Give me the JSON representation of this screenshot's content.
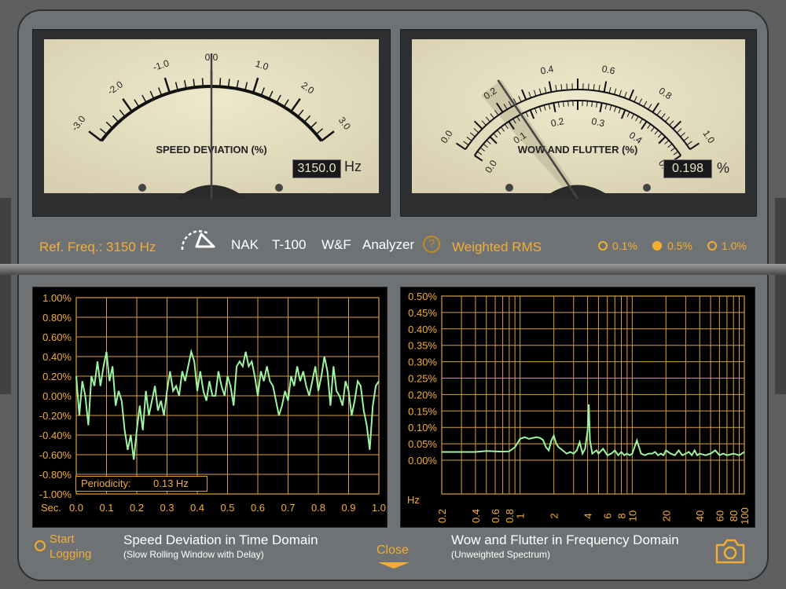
{
  "left_meter": {
    "title": "SPEED DEVIATION (%)",
    "scale_labels": [
      "-3.0",
      "-2.0",
      "-1.0",
      "0.0",
      "1.0",
      "2.0",
      "3.0"
    ],
    "readout": "3150.0",
    "unit": "Hz",
    "needle_value": 0.0
  },
  "right_meter": {
    "title": "WOW AND FLUTTER (%)",
    "outer_labels": [
      "0.0",
      "0.2",
      "0.4",
      "0.6",
      "0.8",
      "1.0"
    ],
    "inner_labels": [
      "0.0",
      "0.1",
      "0.2",
      "0.3",
      "0.4",
      "0.5"
    ],
    "readout": "0.198",
    "unit": "%",
    "needle_value": 0.198
  },
  "controls": {
    "ref_freq": "Ref. Freq.: 3150 Hz",
    "brand": "NAK",
    "model": "T-100",
    "wf": "W&F",
    "analyzer": "Analyzer",
    "help": "?",
    "weighting": "Weighted RMS",
    "options": [
      {
        "label": "0.1%",
        "selected": false
      },
      {
        "label": "0.5%",
        "selected": true
      },
      {
        "label": "1.0%",
        "selected": false
      }
    ]
  },
  "chart_data": [
    {
      "type": "line",
      "title": "Speed Deviation in Time Domain",
      "subtitle": "(Slow Rolling Window with Delay)",
      "y_ticks": [
        "1.00%",
        "0.80%",
        "0.60%",
        "0.40%",
        "0.20%",
        "0.00%",
        "-0.20%",
        "-0.40%",
        "-0.60%",
        "-0.80%",
        "-1.00%"
      ],
      "x_label": "Sec.",
      "x_ticks": [
        "0.0",
        "0.1",
        "0.2",
        "0.3",
        "0.4",
        "0.5",
        "0.6",
        "0.7",
        "0.8",
        "0.9",
        "1.0"
      ],
      "xlim": [
        0,
        1
      ],
      "ylim": [
        -1,
        1
      ],
      "annotation_label": "Periodicity:",
      "annotation_value": "0.13 Hz",
      "x": [
        0.0,
        0.01,
        0.02,
        0.03,
        0.04,
        0.05,
        0.06,
        0.07,
        0.08,
        0.09,
        0.1,
        0.11,
        0.12,
        0.13,
        0.14,
        0.15,
        0.16,
        0.17,
        0.18,
        0.19,
        0.2,
        0.21,
        0.22,
        0.23,
        0.24,
        0.25,
        0.26,
        0.27,
        0.28,
        0.29,
        0.3,
        0.31,
        0.32,
        0.33,
        0.34,
        0.35,
        0.36,
        0.37,
        0.38,
        0.39,
        0.4,
        0.41,
        0.42,
        0.43,
        0.44,
        0.45,
        0.46,
        0.47,
        0.48,
        0.49,
        0.5,
        0.51,
        0.52,
        0.53,
        0.54,
        0.55,
        0.56,
        0.57,
        0.58,
        0.59,
        0.6,
        0.61,
        0.62,
        0.63,
        0.64,
        0.65,
        0.66,
        0.67,
        0.68,
        0.69,
        0.7,
        0.71,
        0.72,
        0.73,
        0.74,
        0.75,
        0.76,
        0.77,
        0.78,
        0.79,
        0.8,
        0.81,
        0.82,
        0.83,
        0.84,
        0.85,
        0.86,
        0.87,
        0.88,
        0.89,
        0.9,
        0.91,
        0.92,
        0.93,
        0.94,
        0.95,
        0.96,
        0.97,
        0.98,
        0.99,
        1.0
      ],
      "y": [
        0.2,
        -0.2,
        0.15,
        0.0,
        -0.3,
        0.2,
        0.1,
        0.35,
        0.1,
        0.3,
        0.45,
        0.15,
        0.3,
        -0.1,
        0.05,
        -0.05,
        -0.35,
        -0.55,
        -0.4,
        -0.65,
        -0.35,
        -0.1,
        -0.35,
        0.05,
        -0.2,
        -0.05,
        0.1,
        -0.15,
        -0.05,
        -0.2,
        0.05,
        0.25,
        0.05,
        0.1,
        0.0,
        0.25,
        0.15,
        0.3,
        0.45,
        0.35,
        0.05,
        0.25,
        0.05,
        -0.05,
        0.15,
        0.0,
        0.0,
        0.25,
        0.1,
        0.0,
        0.2,
        0.1,
        -0.1,
        0.3,
        0.35,
        0.3,
        0.45,
        0.3,
        0.35,
        0.2,
        0.0,
        0.25,
        0.15,
        0.3,
        0.15,
        0.1,
        -0.05,
        -0.2,
        -0.1,
        0.05,
        -0.05,
        0.2,
        0.1,
        0.3,
        0.15,
        0.25,
        0.1,
        0.0,
        0.15,
        0.3,
        0.05,
        0.2,
        0.4,
        0.25,
        -0.1,
        0.3,
        0.05,
        0.0,
        -0.1,
        0.15,
        0.05,
        -0.2,
        -0.05,
        0.15,
        0.1,
        -0.15,
        -0.3,
        -0.55,
        -0.1,
        0.1,
        0.15
      ]
    },
    {
      "type": "line",
      "title": "Wow and Flutter in Frequency Domain",
      "subtitle": "(Unweighted Spectrum)",
      "y_ticks": [
        "0.50%",
        "0.45%",
        "0.40%",
        "0.35%",
        "0.30%",
        "0.25%",
        "0.20%",
        "0.15%",
        "0.10%",
        "0.05%",
        "0.00%"
      ],
      "x_label": "Hz",
      "x_ticks": [
        "0.2",
        "0.4",
        "0.6",
        "0.8",
        "1",
        "2",
        "4",
        "6",
        "8",
        "10",
        "20",
        "40",
        "60",
        "80",
        "100"
      ],
      "x_scale": "log",
      "xlim": [
        0.2,
        100
      ],
      "ylim": [
        0,
        0.5
      ],
      "x": [
        0.2,
        0.3,
        0.4,
        0.5,
        0.6,
        0.7,
        0.8,
        0.9,
        1.0,
        1.1,
        1.2,
        1.3,
        1.4,
        1.5,
        1.6,
        1.7,
        1.8,
        1.9,
        2.0,
        2.1,
        2.2,
        2.4,
        2.6,
        2.8,
        3.0,
        3.2,
        3.4,
        3.6,
        3.8,
        4.0,
        4.1,
        4.2,
        4.4,
        4.6,
        4.8,
        5.0,
        5.5,
        6.0,
        6.5,
        7.0,
        7.5,
        8.0,
        8.5,
        9.0,
        9.5,
        10,
        11,
        12,
        13,
        14,
        15,
        16,
        17,
        18,
        19,
        20,
        22,
        24,
        26,
        28,
        30,
        32,
        34,
        36,
        38,
        40,
        45,
        50,
        55,
        60,
        65,
        70,
        80,
        90,
        100
      ],
      "y": [
        0.025,
        0.025,
        0.025,
        0.028,
        0.027,
        0.026,
        0.027,
        0.04,
        0.065,
        0.07,
        0.065,
        0.068,
        0.07,
        0.068,
        0.062,
        0.04,
        0.03,
        0.06,
        0.075,
        0.05,
        0.04,
        0.03,
        0.02,
        0.025,
        0.02,
        0.03,
        0.055,
        0.02,
        0.035,
        0.09,
        0.17,
        0.06,
        0.02,
        0.025,
        0.03,
        0.02,
        0.035,
        0.015,
        0.02,
        0.03,
        0.015,
        0.025,
        0.015,
        0.02,
        0.015,
        0.02,
        0.06,
        0.02,
        0.015,
        0.02,
        0.02,
        0.025,
        0.015,
        0.02,
        0.015,
        0.03,
        0.02,
        0.015,
        0.03,
        0.015,
        0.02,
        0.025,
        0.015,
        0.03,
        0.015,
        0.02,
        0.015,
        0.02,
        0.03,
        0.015,
        0.02,
        0.015,
        0.02,
        0.015,
        0.025
      ]
    }
  ],
  "bottom": {
    "start_logging_line1": "Start",
    "start_logging_line2": "Logging",
    "left_title": "Speed Deviation in Time Domain",
    "left_subtitle": "(Slow Rolling Window with Delay)",
    "close": "Close",
    "right_title": "Wow and Flutter in Frequency Domain",
    "right_subtitle": "(Unweighted Spectrum)"
  },
  "colors": {
    "accent": "#f2ae33",
    "trace": "#9df5a4",
    "meter_face": "#ebe4c8",
    "grid": "#d8a040"
  }
}
